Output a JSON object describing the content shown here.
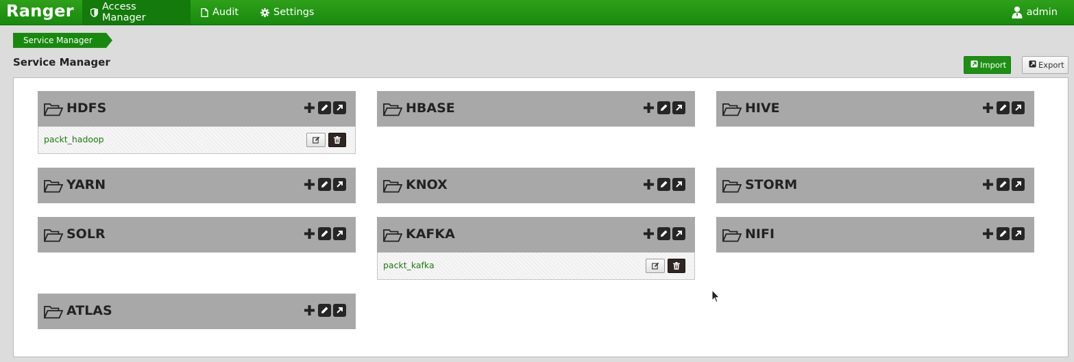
{
  "navbar": {
    "brand": "Ranger",
    "items": [
      {
        "label": "Access Manager",
        "icon": "shield-icon",
        "active": true
      },
      {
        "label": "Audit",
        "icon": "file-icon",
        "active": false
      },
      {
        "label": "Settings",
        "icon": "gear-icon",
        "active": false
      }
    ],
    "user": {
      "label": "admin",
      "icon": "user-icon"
    }
  },
  "breadcrumb": {
    "label": "Service Manager"
  },
  "page": {
    "title": "Service Manager"
  },
  "toolbar": {
    "import_label": "Import",
    "export_label": "Export"
  },
  "colors": {
    "brand": "#1d8f14",
    "header": "#a8a8a8",
    "link": "#1d7a10"
  },
  "services": [
    {
      "name": "HDFS",
      "instances": [
        "packt_hadoop"
      ]
    },
    {
      "name": "HBASE",
      "instances": []
    },
    {
      "name": "HIVE",
      "instances": []
    },
    {
      "name": "YARN",
      "instances": []
    },
    {
      "name": "KNOX",
      "instances": []
    },
    {
      "name": "STORM",
      "instances": []
    },
    {
      "name": "SOLR",
      "instances": []
    },
    {
      "name": "KAFKA",
      "instances": [
        "packt_kafka"
      ]
    },
    {
      "name": "NIFI",
      "instances": []
    },
    {
      "name": "ATLAS",
      "instances": []
    }
  ]
}
